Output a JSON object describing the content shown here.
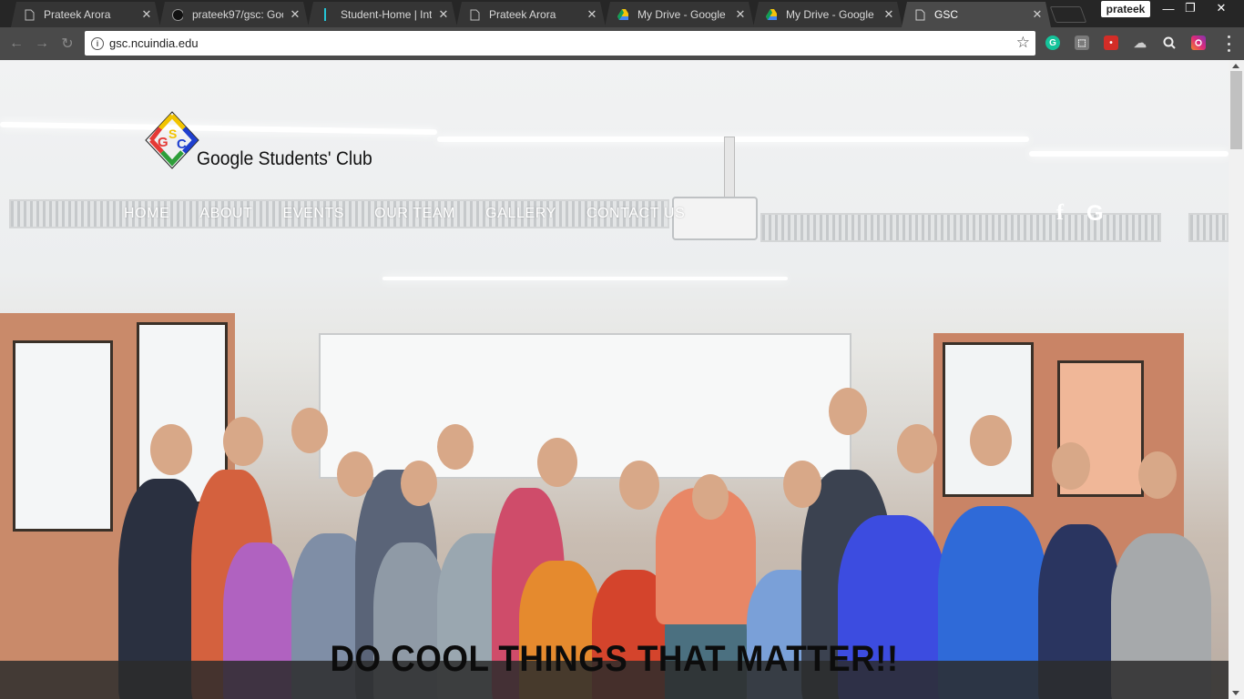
{
  "browser": {
    "tabs": [
      {
        "title": "Prateek Arora",
        "icon": "page-icon"
      },
      {
        "title": "prateek97/gsc: Goo",
        "icon": "github-icon"
      },
      {
        "title": "Student-Home | Int",
        "icon": "bar-icon"
      },
      {
        "title": "Prateek Arora",
        "icon": "page-icon"
      },
      {
        "title": "My Drive - Google",
        "icon": "google-drive-icon"
      },
      {
        "title": "My Drive - Google",
        "icon": "google-drive-icon"
      },
      {
        "title": "GSC",
        "icon": "page-icon",
        "active": true
      }
    ],
    "tab_close": "✕",
    "profile_name": "prateek",
    "window_controls": {
      "minimize": "—",
      "restore": "❐",
      "close": "✕"
    },
    "url": "gsc.ncuindia.edu",
    "nav_buttons": {
      "back": "←",
      "forward": "→",
      "reload": "↻"
    },
    "extensions": [
      "grammarly-icon",
      "pdf-icon",
      "lastpass-icon",
      "cloud-icon",
      "search-icon",
      "instagram-icon"
    ]
  },
  "site": {
    "logo_text": "Google Students' Club",
    "nav": [
      "HOME",
      "ABOUT",
      "EVENTS",
      "OUR TEAM",
      "GALLERY",
      "CONTACT US"
    ],
    "social": {
      "facebook": "f",
      "google": "G"
    },
    "tagline": "DO COOL THINGS THAT MATTER!!",
    "accent_colors": {
      "red": "#e53935",
      "yellow": "#f2c400",
      "blue": "#1e3fcf",
      "green": "#2e9e3a"
    }
  }
}
